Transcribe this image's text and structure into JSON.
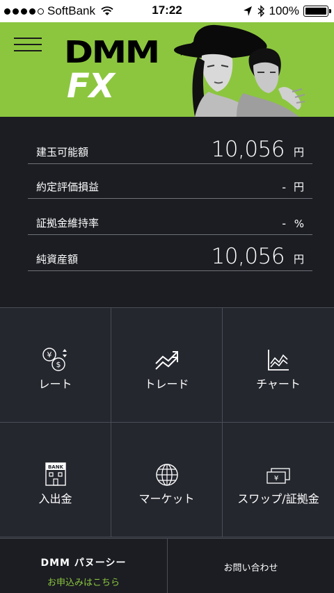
{
  "status_bar": {
    "carrier": "SoftBank",
    "time": "17:22",
    "battery": "100%"
  },
  "header": {
    "logo_top": "DMM",
    "logo_bottom": "FX"
  },
  "account": {
    "rows": [
      {
        "label": "建玉可能額",
        "value": "10,056",
        "unit": "円"
      },
      {
        "label": "約定評価損益",
        "value": "-",
        "unit": "円"
      },
      {
        "label": "証拠金維持率",
        "value": "-",
        "unit": "%"
      },
      {
        "label": "純資産額",
        "value": "10,056",
        "unit": "円"
      }
    ]
  },
  "menu": {
    "tiles": [
      {
        "label": "レート",
        "icon": "rate-icon"
      },
      {
        "label": "トレード",
        "icon": "trade-icon"
      },
      {
        "label": "チャート",
        "icon": "chart-icon"
      },
      {
        "label": "入出金",
        "icon": "bank-icon"
      },
      {
        "label": "マーケット",
        "icon": "globe-icon"
      },
      {
        "label": "スワップ/証拠金",
        "icon": "yen-bill-icon"
      }
    ]
  },
  "footer": {
    "partner_logo": "DMM パヌーシー",
    "partner_link": "お申込みはこちら",
    "contact": "お問い合わせ"
  },
  "colors": {
    "brand_green": "#8cc63f",
    "background": "#1b1d22",
    "tile": "#25272f"
  }
}
